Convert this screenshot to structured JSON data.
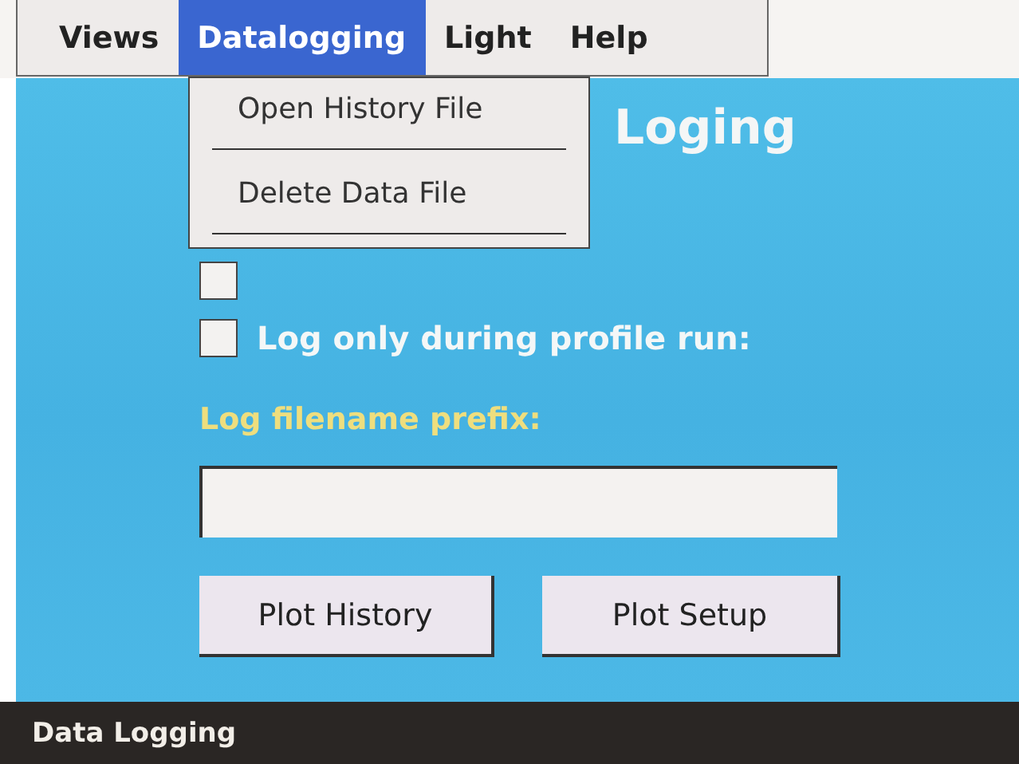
{
  "menu_bar": [
    {
      "label": "Views",
      "selected": false
    },
    {
      "label": "Datalogging",
      "selected": true
    },
    {
      "label": "Light",
      "selected": false
    },
    {
      "label": "Help",
      "selected": false
    }
  ],
  "dropdown": {
    "items": [
      {
        "label": "Open History File"
      },
      {
        "label": "Delete Data File"
      }
    ]
  },
  "heading": "Loging",
  "options": [
    {
      "checked": false
    },
    {
      "label": "Log only during profile run:",
      "checked": false
    }
  ],
  "prefix_label": "Log filename prefix:",
  "buttons": [
    "Plot History",
    "Plot Setup"
  ],
  "status_bar": "Data Logging"
}
